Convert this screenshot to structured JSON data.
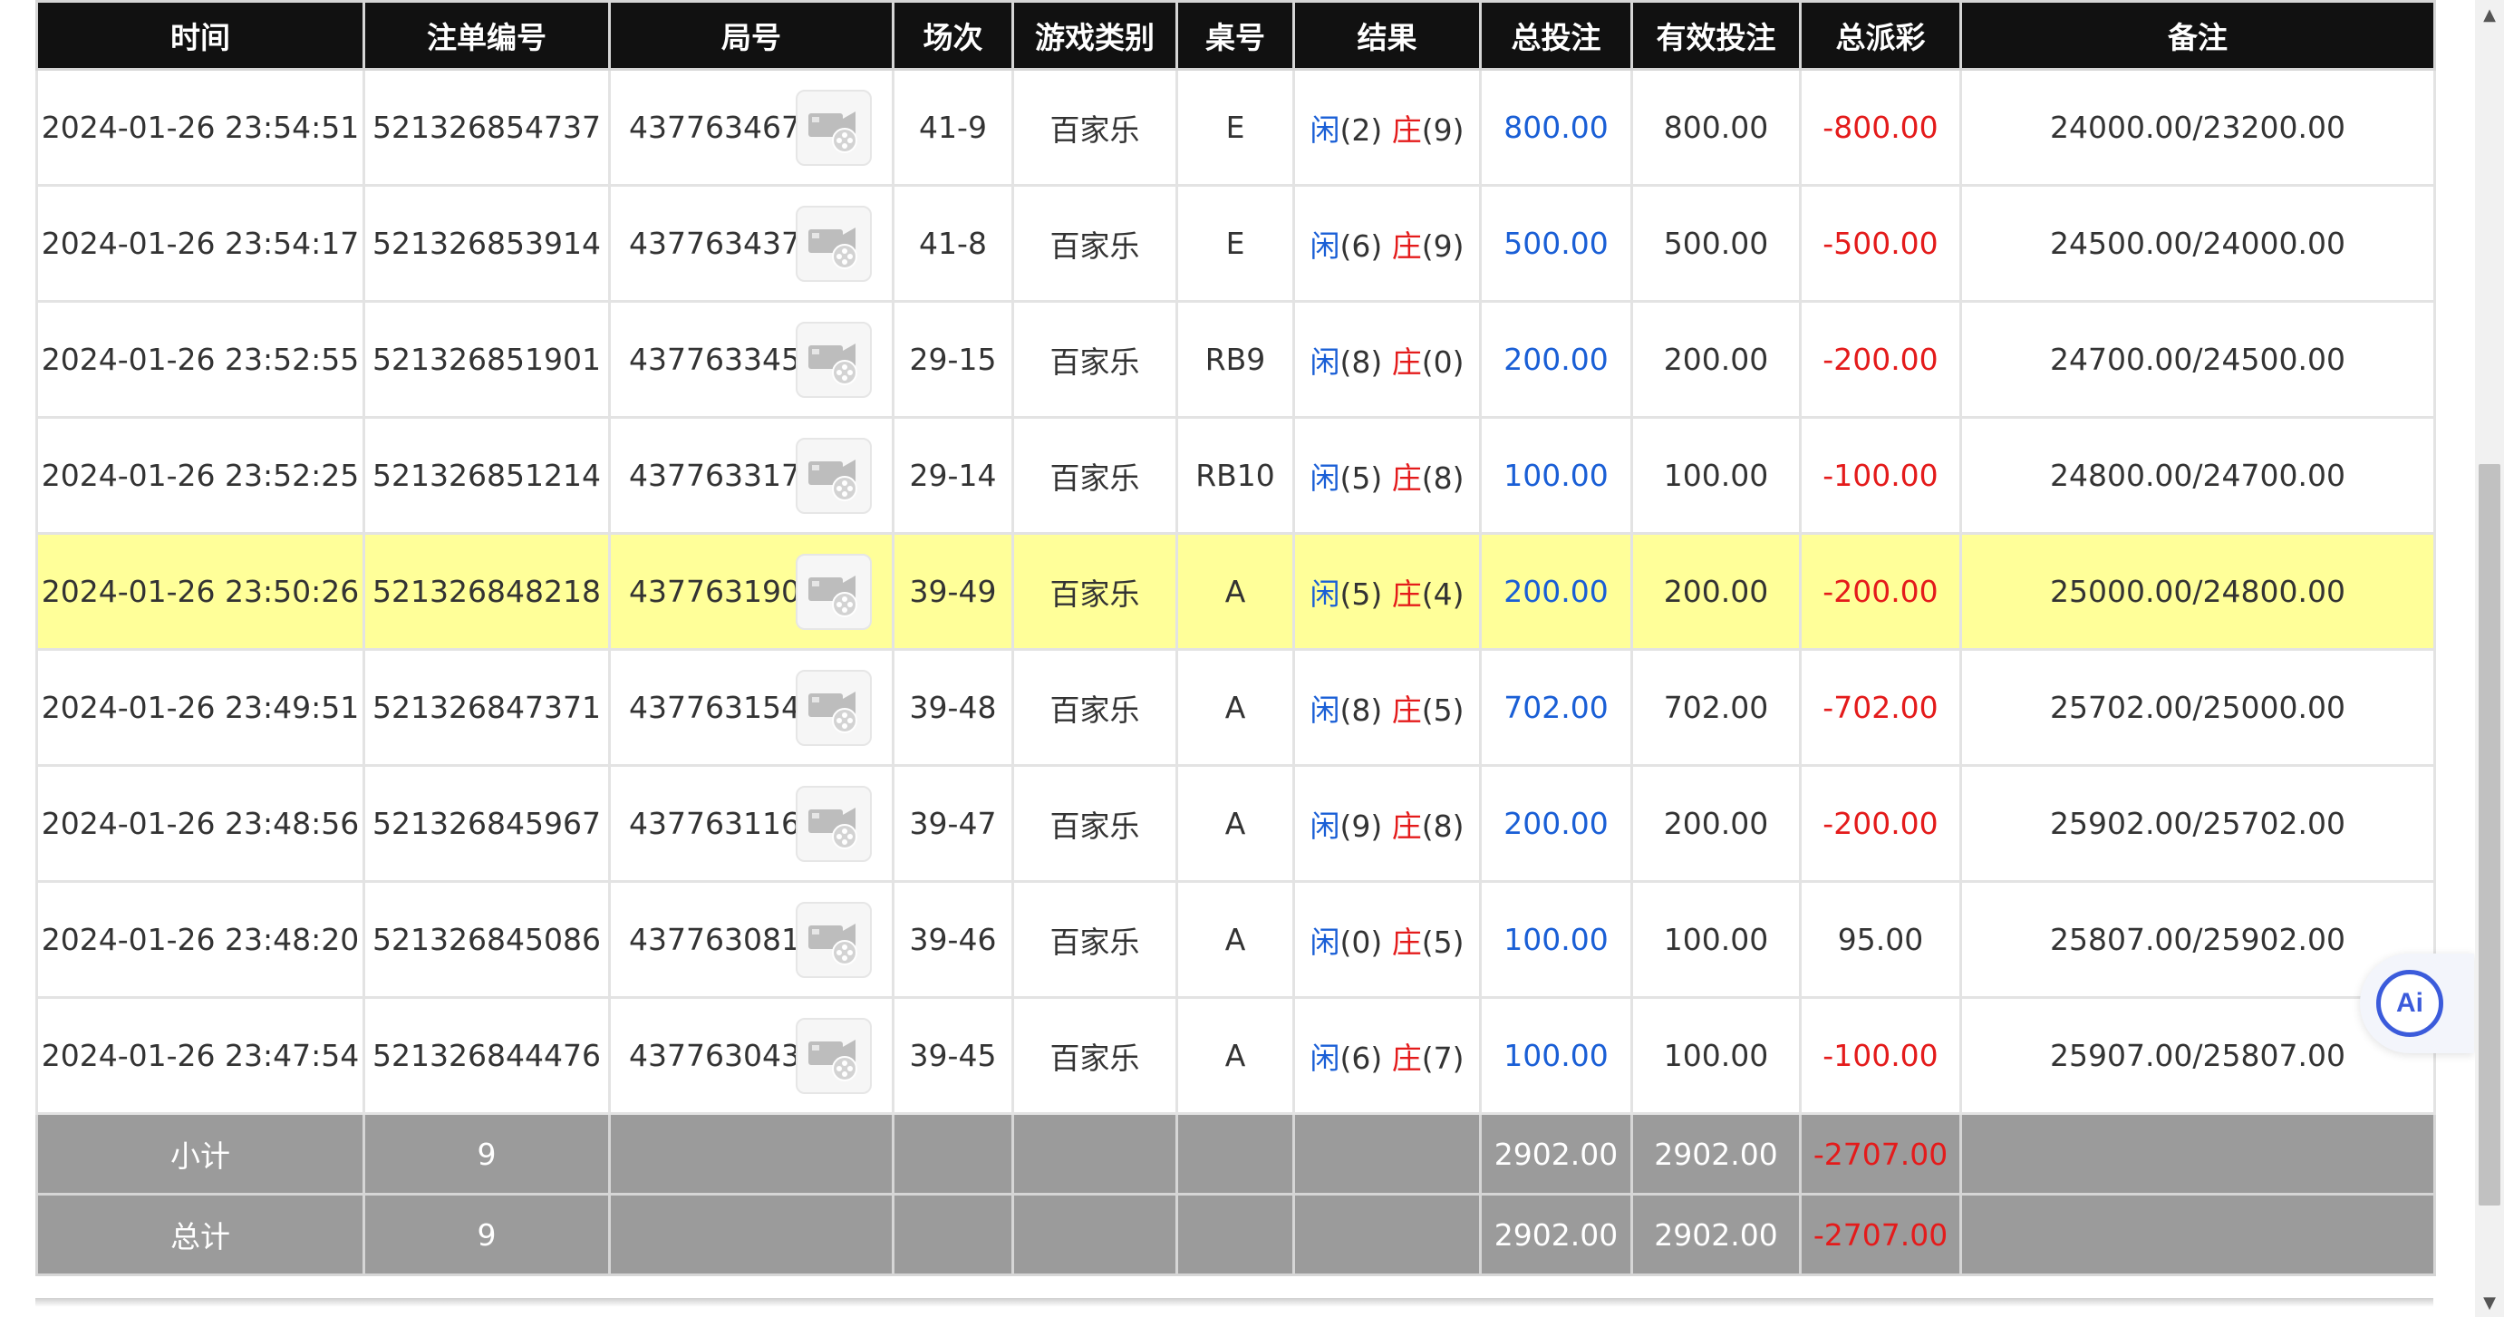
{
  "columns": [
    "时间",
    "注单编号",
    "局号",
    "场次",
    "游戏类别",
    "桌号",
    "结果",
    "总投注",
    "有效投注",
    "总派彩",
    "备注"
  ],
  "result_labels": {
    "player": "闲",
    "banker": "庄"
  },
  "rows": [
    {
      "time": "2024-01-26 23:54:51",
      "bet_id": "521326854737",
      "round": "437763467",
      "session": "41-9",
      "game": "百家乐",
      "table": "E",
      "player_score": "(2)",
      "banker_score": "(9)",
      "total_bet": "800.00",
      "valid_bet": "800.00",
      "payout": "-800.00",
      "payout_negative": true,
      "remark": "24000.00/23200.00",
      "highlight": false
    },
    {
      "time": "2024-01-26 23:54:17",
      "bet_id": "521326853914",
      "round": "437763437",
      "session": "41-8",
      "game": "百家乐",
      "table": "E",
      "player_score": "(6)",
      "banker_score": "(9)",
      "total_bet": "500.00",
      "valid_bet": "500.00",
      "payout": "-500.00",
      "payout_negative": true,
      "remark": "24500.00/24000.00",
      "highlight": false
    },
    {
      "time": "2024-01-26 23:52:55",
      "bet_id": "521326851901",
      "round": "437763345",
      "session": "29-15",
      "game": "百家乐",
      "table": "RB9",
      "player_score": "(8)",
      "banker_score": "(0)",
      "total_bet": "200.00",
      "valid_bet": "200.00",
      "payout": "-200.00",
      "payout_negative": true,
      "remark": "24700.00/24500.00",
      "highlight": false
    },
    {
      "time": "2024-01-26 23:52:25",
      "bet_id": "521326851214",
      "round": "437763317",
      "session": "29-14",
      "game": "百家乐",
      "table": "RB10",
      "player_score": "(5)",
      "banker_score": "(8)",
      "total_bet": "100.00",
      "valid_bet": "100.00",
      "payout": "-100.00",
      "payout_negative": true,
      "remark": "24800.00/24700.00",
      "highlight": false
    },
    {
      "time": "2024-01-26 23:50:26",
      "bet_id": "521326848218",
      "round": "437763190",
      "session": "39-49",
      "game": "百家乐",
      "table": "A",
      "player_score": "(5)",
      "banker_score": "(4)",
      "total_bet": "200.00",
      "valid_bet": "200.00",
      "payout": "-200.00",
      "payout_negative": true,
      "remark": "25000.00/24800.00",
      "highlight": true
    },
    {
      "time": "2024-01-26 23:49:51",
      "bet_id": "521326847371",
      "round": "437763154",
      "session": "39-48",
      "game": "百家乐",
      "table": "A",
      "player_score": "(8)",
      "banker_score": "(5)",
      "total_bet": "702.00",
      "valid_bet": "702.00",
      "payout": "-702.00",
      "payout_negative": true,
      "remark": "25702.00/25000.00",
      "highlight": false
    },
    {
      "time": "2024-01-26 23:48:56",
      "bet_id": "521326845967",
      "round": "437763116",
      "session": "39-47",
      "game": "百家乐",
      "table": "A",
      "player_score": "(9)",
      "banker_score": "(8)",
      "total_bet": "200.00",
      "valid_bet": "200.00",
      "payout": "-200.00",
      "payout_negative": true,
      "remark": "25902.00/25702.00",
      "highlight": false
    },
    {
      "time": "2024-01-26 23:48:20",
      "bet_id": "521326845086",
      "round": "437763081",
      "session": "39-46",
      "game": "百家乐",
      "table": "A",
      "player_score": "(0)",
      "banker_score": "(5)",
      "total_bet": "100.00",
      "valid_bet": "100.00",
      "payout": "95.00",
      "payout_negative": false,
      "remark": "25807.00/25902.00",
      "highlight": false
    },
    {
      "time": "2024-01-26 23:47:54",
      "bet_id": "521326844476",
      "round": "437763043",
      "session": "39-45",
      "game": "百家乐",
      "table": "A",
      "player_score": "(6)",
      "banker_score": "(7)",
      "total_bet": "100.00",
      "valid_bet": "100.00",
      "payout": "-100.00",
      "payout_negative": true,
      "remark": "25907.00/25807.00",
      "highlight": false
    }
  ],
  "summary": [
    {
      "label": "小计",
      "count": "9",
      "total_bet": "2902.00",
      "valid_bet": "2902.00",
      "payout": "-2707.00"
    },
    {
      "label": "总计",
      "count": "9",
      "total_bet": "2902.00",
      "valid_bet": "2902.00",
      "payout": "-2707.00"
    }
  ],
  "ai_badge": {
    "label": "Ai"
  },
  "colors": {
    "header_bg": "#111111",
    "highlight": "#ffff99",
    "summary_bg": "#9b9b9b",
    "blue": "#1a5fd6",
    "red": "#e41b1b"
  }
}
